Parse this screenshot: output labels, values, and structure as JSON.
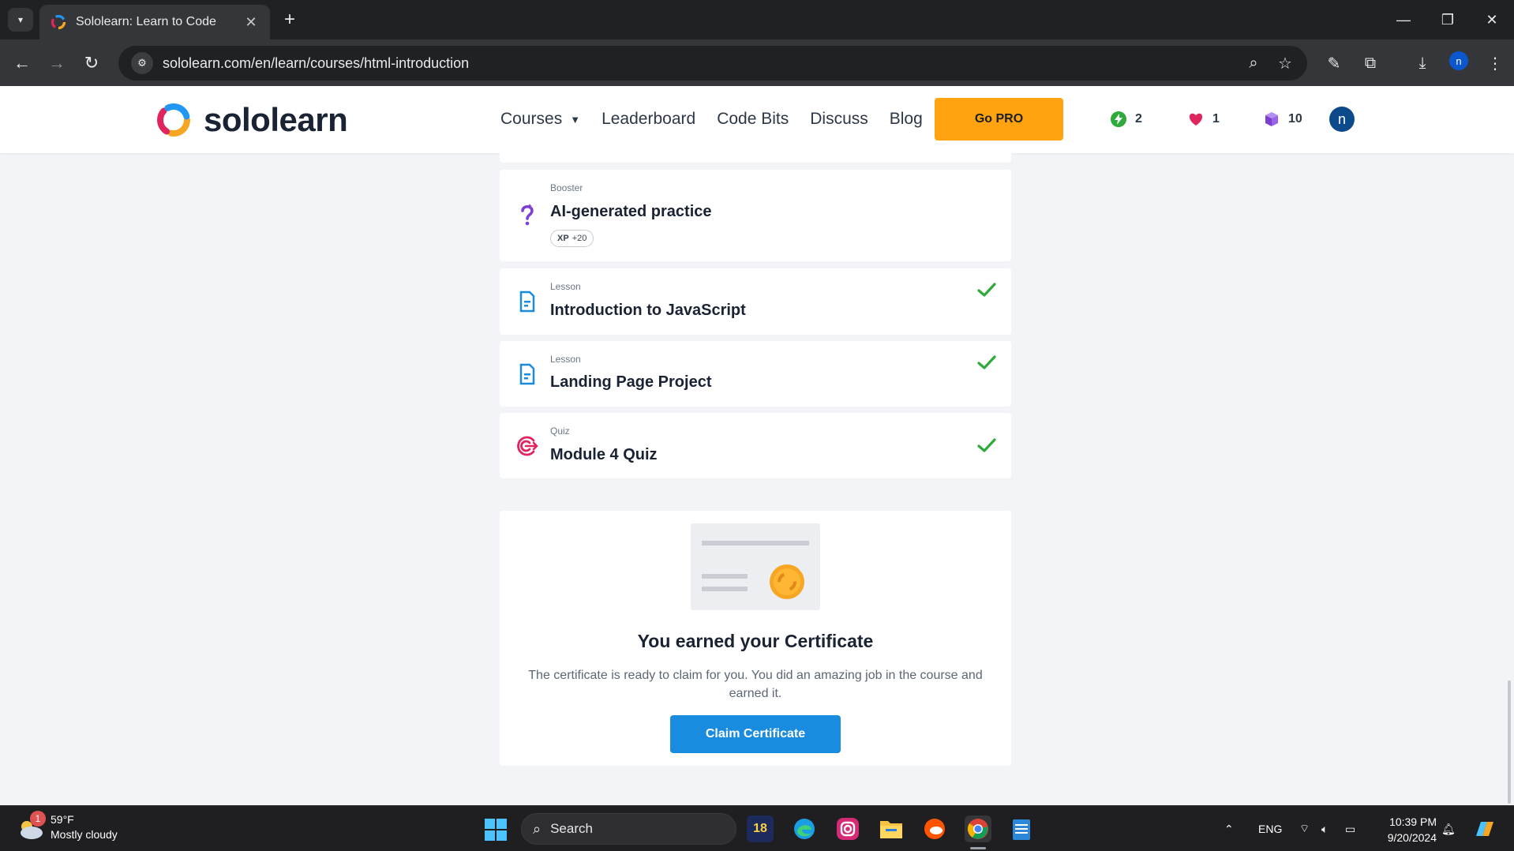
{
  "browser": {
    "tab_title": "Sololearn: Learn to Code",
    "url": "sololearn.com/en/learn/courses/html-introduction",
    "profile_initial": "n"
  },
  "site": {
    "logo_text": "sololearn",
    "nav": {
      "courses": "Courses",
      "leaderboard": "Leaderboard",
      "code_bits": "Code Bits",
      "discuss": "Discuss",
      "blog": "Blog"
    },
    "go_pro": "Go PRO",
    "streak": "2",
    "hearts": "1",
    "bits": "10",
    "avatar_initial": "n"
  },
  "items": [
    {
      "type": "Booster",
      "title": "AI-generated practice",
      "xp_label": "XP",
      "xp_value": "+20",
      "completed": false
    },
    {
      "type": "Lesson",
      "title": "Introduction to JavaScript",
      "completed": true
    },
    {
      "type": "Lesson",
      "title": "Landing Page Project",
      "completed": true
    },
    {
      "type": "Quiz",
      "title": "Module 4 Quiz",
      "completed": true
    }
  ],
  "certificate": {
    "title": "You earned your Certificate",
    "description": "The certificate is ready to claim for you. You did an amazing job in the course and earned it.",
    "button": "Claim Certificate"
  },
  "taskbar": {
    "weather_temp": "59°F",
    "weather_desc": "Mostly cloudy",
    "weather_badge": "1",
    "search_placeholder": "Search",
    "app_18_label": "18",
    "lang": "ENG",
    "time": "10:39 PM",
    "date": "9/20/2024"
  },
  "colors": {
    "brand_orange": "#ffa310",
    "claim_blue": "#1a8cdf",
    "check_green": "#2faa3a",
    "lesson_blue": "#1a8cdf",
    "quiz_pink": "#e0245e",
    "booster_purple": "#7b3fd1"
  }
}
